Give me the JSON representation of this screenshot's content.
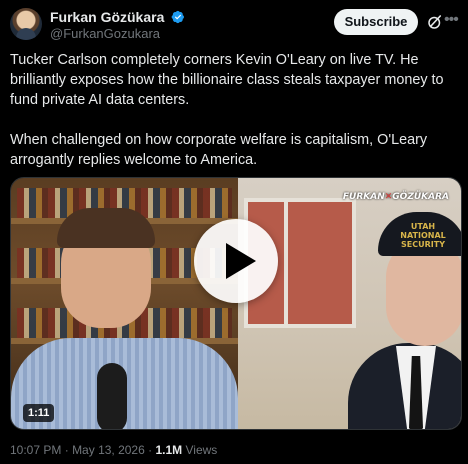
{
  "author": {
    "display_name": "Furkan Gözükara",
    "handle": "@FurkanGozukara",
    "verified": true,
    "avatar_icon": "profile-avatar"
  },
  "actions": {
    "subscribe_label": "Subscribe",
    "grok_icon": "grok-icon",
    "more_icon": "more-options-icon"
  },
  "post": {
    "paragraph_1": "Tucker Carlson completely corners Kevin O'Leary on live TV. He brilliantly exposes how the billionaire class steals taxpayer money to fund private AI data centers.",
    "paragraph_2": "When challenged on how corporate welfare is capitalism, O'Leary arrogantly replies welcome to America."
  },
  "media": {
    "duration": "1:11",
    "watermark_left": "FURKAN",
    "watermark_right": "GÖZÜKARA",
    "cap_line_1": "UTAH",
    "cap_line_2": "NATIONAL SECURITY",
    "play_icon": "play-icon"
  },
  "meta": {
    "time": "10:07 PM",
    "date": "May 13, 2026",
    "separator": "·",
    "views_count": "1.1M",
    "views_label": "Views"
  },
  "colors": {
    "background": "#000000",
    "text_primary": "#e7e9ea",
    "text_secondary": "#71767b",
    "verified_blue": "#1d9bf0",
    "subscribe_bg": "#eff3f4"
  }
}
